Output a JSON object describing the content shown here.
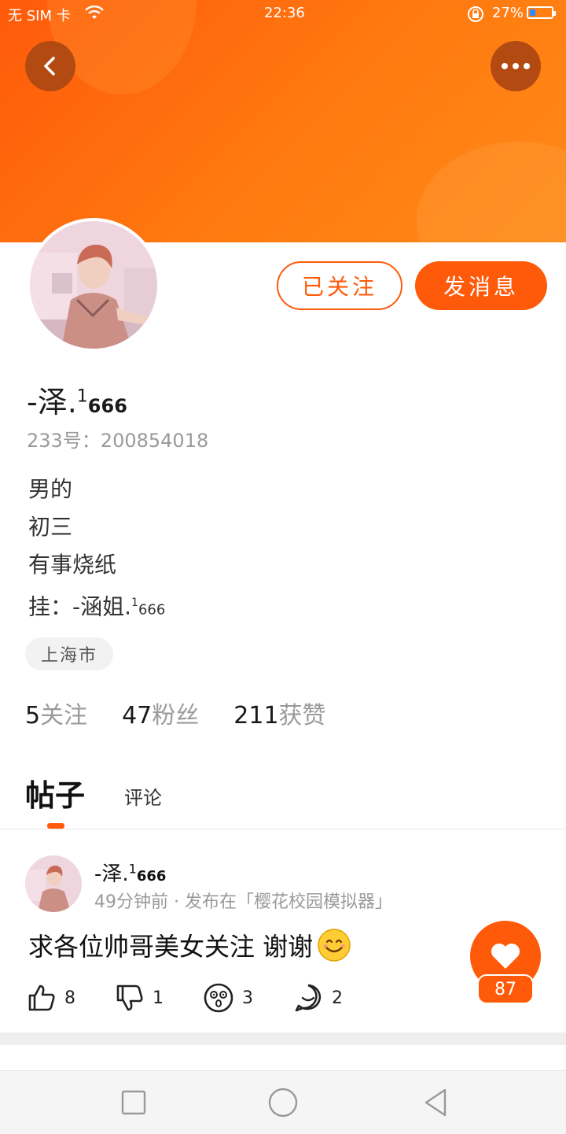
{
  "status_bar": {
    "carrier": "无 SIM 卡",
    "time": "22:36",
    "battery": "27%",
    "battery_level": 0.27
  },
  "header": {
    "back_icon": "chevron-left-icon",
    "more_icon": "more-dots-icon"
  },
  "profile": {
    "name_main": "-泽.",
    "name_sup": "1",
    "name_sub": "666",
    "uid": "233号：200854018",
    "bio": {
      "line1": "男的",
      "line2": "初三",
      "line3": "有事烧纸",
      "line4_main": "挂：-涵姐.",
      "line4_sup": "1",
      "line4_sub": "666"
    },
    "location": "上海市",
    "stats": {
      "following_count": "5",
      "following_label": "关注",
      "fans_count": "47",
      "fans_label": "粉丝",
      "likes_count": "211",
      "likes_label": "获赞"
    }
  },
  "buttons": {
    "followed": "已关注",
    "message": "发消息"
  },
  "tabs": {
    "posts": "帖子",
    "comments": "评论"
  },
  "post": {
    "author_main": "-泽.",
    "author_sup": "1",
    "author_sub": "666",
    "meta": "49分钟前 · 发布在「樱花校园模拟器」",
    "text": "求各位帅哥美女关注  谢谢",
    "likes": "8",
    "dislikes": "1",
    "surprised": "3",
    "comments": "2",
    "heart_count": "87"
  },
  "colors": {
    "accent": "#ff5a0a",
    "header_gradient_start": "#ff5a0a",
    "header_gradient_end": "#ff8a18"
  }
}
